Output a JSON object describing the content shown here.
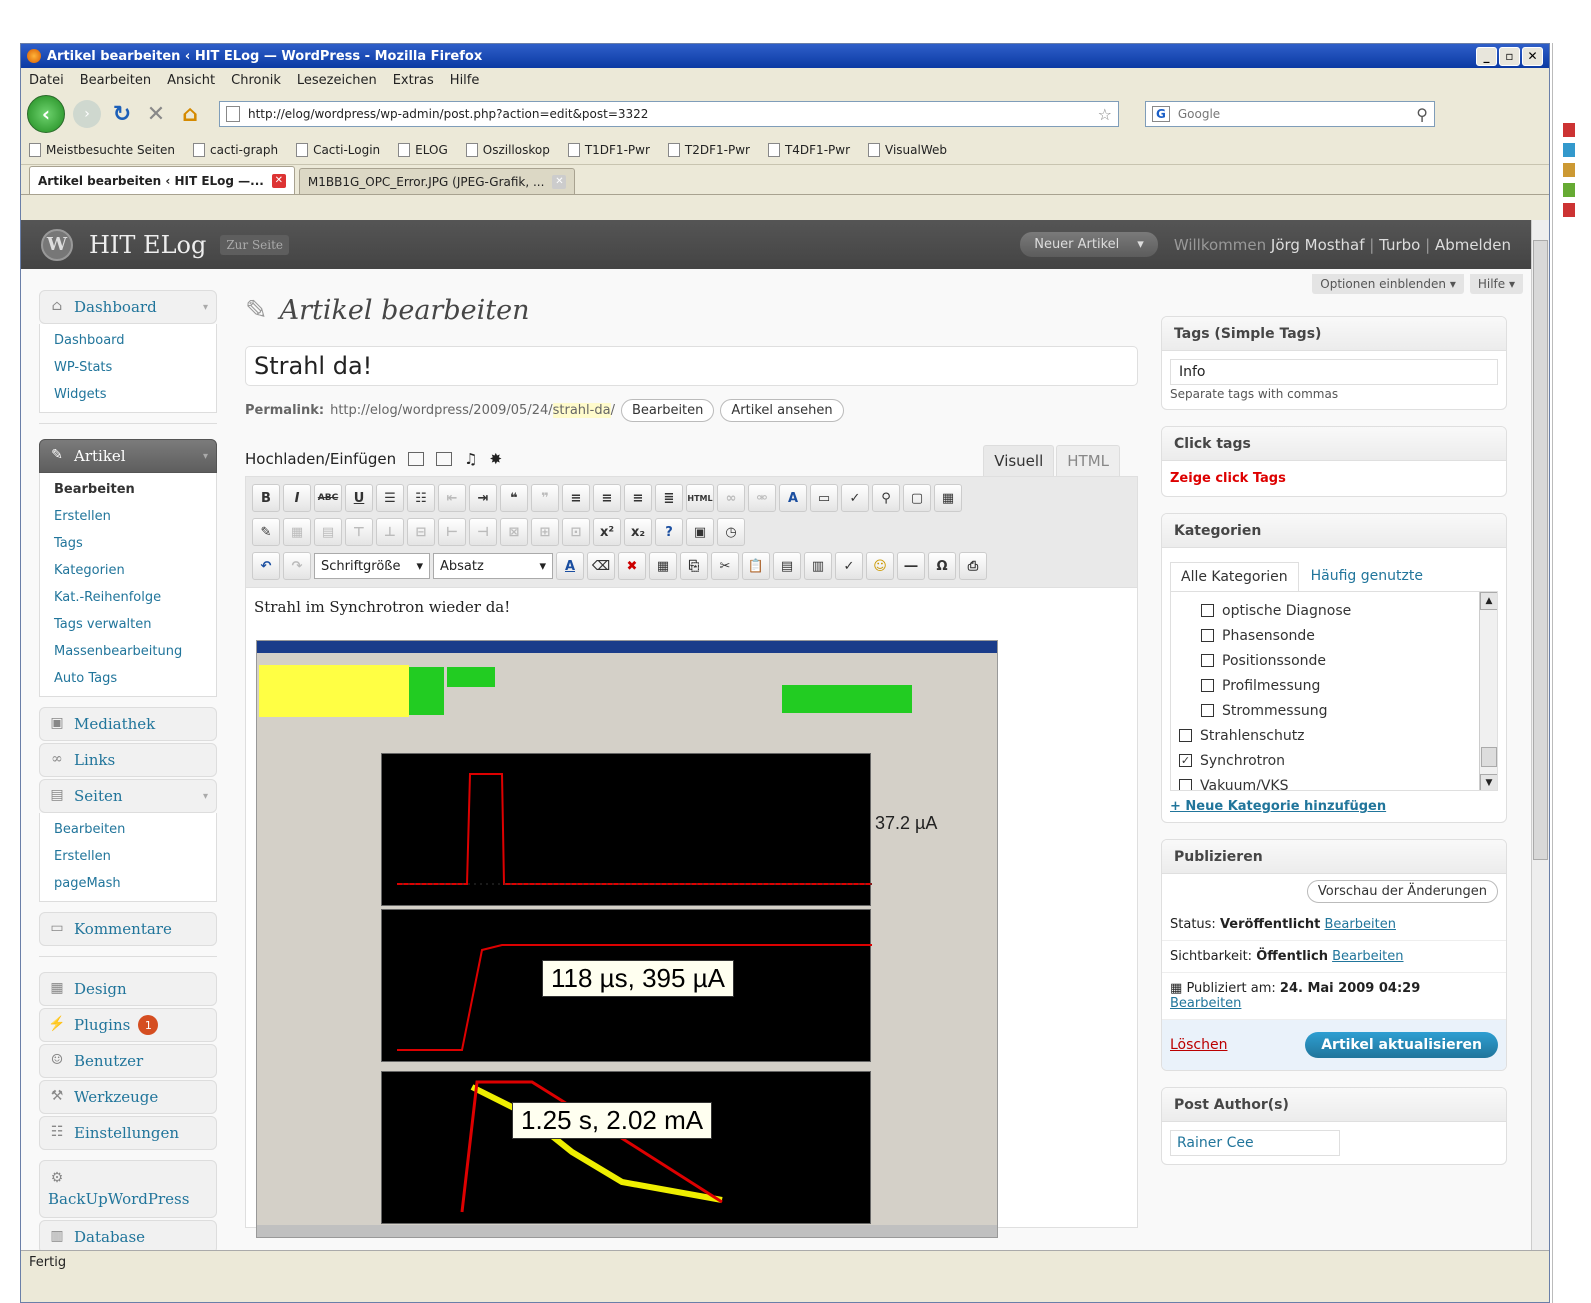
{
  "browser": {
    "window_title": "Artikel bearbeiten ‹ HIT ELog — WordPress - Mozilla Firefox",
    "menu": [
      "Datei",
      "Bearbeiten",
      "Ansicht",
      "Chronik",
      "Lesezeichen",
      "Extras",
      "Hilfe"
    ],
    "url": "http://elog/wordpress/wp-admin/post.php?action=edit&post=3322",
    "search_placeholder": "Google",
    "bookmarks": [
      "Meistbesuchte Seiten",
      "cacti-graph",
      "Cacti-Login",
      "ELOG",
      "Oszilloskop",
      "T1DF1-Pwr",
      "T2DF1-Pwr",
      "T4DF1-Pwr",
      "VisualWeb"
    ],
    "tabs": [
      "Artikel bearbeiten ‹ HIT ELog —...",
      "M1BB1G_OPC_Error.JPG (JPEG-Grafik, ..."
    ],
    "status": "Fertig"
  },
  "wp": {
    "site_title": "HIT ELog",
    "visit_site": "Zur Seite",
    "new_post": "Neuer Artikel",
    "welcome": "Willkommen",
    "user": "Jörg Mosthaf",
    "turbo": "Turbo",
    "logout": "Abmelden",
    "screen_options": "Optionen einblenden",
    "help": "Hilfe"
  },
  "sidebar": {
    "dashboard": {
      "label": "Dashboard",
      "items": [
        "Dashboard",
        "WP-Stats",
        "Widgets"
      ]
    },
    "artikel": {
      "label": "Artikel",
      "items": [
        "Bearbeiten",
        "Erstellen",
        "Tags",
        "Kategorien",
        "Kat.-Reihenfolge",
        "Tags verwalten",
        "Massenbearbeitung",
        "Auto Tags"
      ]
    },
    "mediathek": "Mediathek",
    "links": "Links",
    "seiten": {
      "label": "Seiten",
      "items": [
        "Bearbeiten",
        "Erstellen",
        "pageMash"
      ]
    },
    "kommentare": "Kommentare",
    "design": "Design",
    "plugins": "Plugins",
    "plugins_badge": "1",
    "benutzer": "Benutzer",
    "werkzeuge": "Werkzeuge",
    "einstellungen": "Einstellungen",
    "backup": "BackUpWordPress",
    "database": "Database"
  },
  "main": {
    "heading": "Artikel bearbeiten",
    "post_title": "Strahl da!",
    "permalink_label": "Permalink:",
    "permalink_base": "http://elog/wordpress/2009/05/24/",
    "permalink_slug": "strahl-da",
    "permalink_end": "/",
    "edit_btn": "Bearbeiten",
    "view_btn": "Artikel ansehen",
    "upload_label": "Hochladen/Einfügen",
    "tab_visual": "Visuell",
    "tab_html": "HTML",
    "font_size": "Schriftgröße",
    "format": "Absatz",
    "body_text": "Strahl im Synchrotron wieder da!",
    "shot_labels": {
      "value1": "37.2 µA",
      "label2": "118 µs, 395 µA",
      "label3": "1.25 s, 2.02 mA"
    }
  },
  "right": {
    "tags_title": "Tags (Simple Tags)",
    "tags_value": "Info",
    "tags_note": "Separate tags with commas",
    "click_title": "Click tags",
    "click_link": "Zeige click Tags",
    "cat_title": "Kategorien",
    "cat_tab_all": "Alle Kategorien",
    "cat_tab_freq": "Häufig genutzte",
    "categories": [
      {
        "name": "optische Diagnose",
        "checked": false,
        "indent": true
      },
      {
        "name": "Phasensonde",
        "checked": false,
        "indent": true
      },
      {
        "name": "Positionssonde",
        "checked": false,
        "indent": true
      },
      {
        "name": "Profilmessung",
        "checked": false,
        "indent": true
      },
      {
        "name": "Strommessung",
        "checked": false,
        "indent": true
      },
      {
        "name": "Strahlenschutz",
        "checked": false,
        "indent": false
      },
      {
        "name": "Synchrotron",
        "checked": true,
        "indent": false
      },
      {
        "name": "Vakuum/VKS",
        "checked": false,
        "indent": false
      }
    ],
    "add_cat": "+ Neue Kategorie hinzufügen",
    "pub_title": "Publizieren",
    "preview": "Vorschau der Änderungen",
    "status_label": "Status:",
    "status_value": "Veröffentlicht",
    "status_edit": "Bearbeiten",
    "vis_label": "Sichtbarkeit:",
    "vis_value": "Öffentlich",
    "vis_edit": "Bearbeiten",
    "published_label": "Publiziert am:",
    "published_value": "24. Mai 2009 04:29",
    "published_edit": "Bearbeiten",
    "delete": "Löschen",
    "update": "Artikel aktualisieren",
    "author_title": "Post Author(s)",
    "author": "Rainer Cee"
  }
}
